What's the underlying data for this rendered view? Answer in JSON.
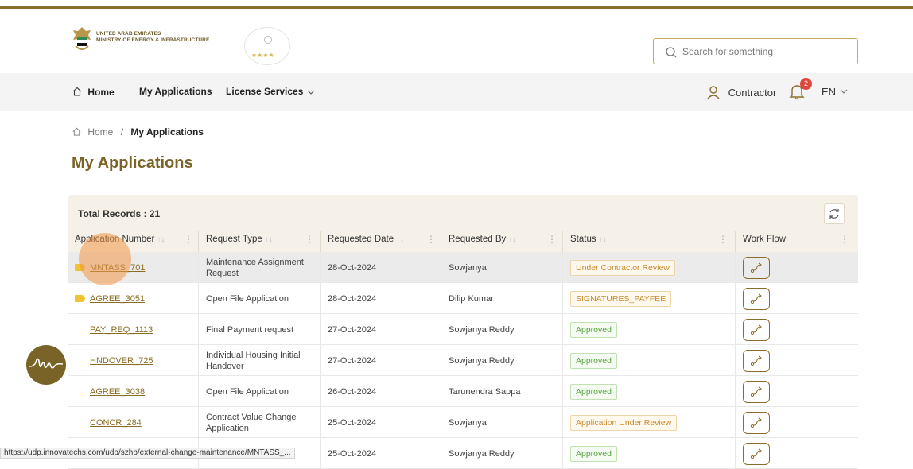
{
  "header": {
    "org_line1": "UNITED ARAB EMIRATES",
    "org_line2": "MINISTRY OF ENERGY & INFRASTRUCTURE",
    "seal_stars": "★★★★",
    "search_placeholder": "Search for something"
  },
  "nav": {
    "home": "Home",
    "my_applications": "My Applications",
    "license_services": "License Services",
    "user": "Contractor",
    "notification_count": "2",
    "language": "EN"
  },
  "breadcrumb": {
    "home": "Home",
    "separator": "/",
    "current": "My Applications"
  },
  "page_title": "My Applications",
  "table": {
    "total_records": "Total Records : 21",
    "columns": {
      "app_number": "Application Number",
      "request_type": "Request Type",
      "requested_date": "Requested Date",
      "requested_by": "Requested By",
      "status": "Status",
      "work_flow": "Work Flow"
    },
    "rows": [
      {
        "app_number": "MNTASS_701",
        "request_type": "Maintenance Assignment Request",
        "requested_date": "28-Oct-2024",
        "requested_by": "Sowjanya",
        "status": "Under Contractor Review",
        "status_color": "orange",
        "flag": true
      },
      {
        "app_number": "AGREE_3051",
        "request_type": "Open File Application",
        "requested_date": "28-Oct-2024",
        "requested_by": "Dilip Kumar",
        "status": "SIGNATURES_PAYFEE",
        "status_color": "orange",
        "flag": true
      },
      {
        "app_number": "PAY_REQ_1113",
        "request_type": "Final Payment request",
        "requested_date": "27-Oct-2024",
        "requested_by": "Sowjanya Reddy",
        "status": "Approved",
        "status_color": "green",
        "flag": false
      },
      {
        "app_number": "HNDOVER_725",
        "request_type": "Individual Housing Initial Handover",
        "requested_date": "27-Oct-2024",
        "requested_by": "Sowjanya Reddy",
        "status": "Approved",
        "status_color": "green",
        "flag": false
      },
      {
        "app_number": "AGREE_3038",
        "request_type": "Open File Application",
        "requested_date": "26-Oct-2024",
        "requested_by": "Tarunendra Sappa",
        "status": "Approved",
        "status_color": "green",
        "flag": false
      },
      {
        "app_number": "CONCR_284",
        "request_type": "Contract Value Change Application",
        "requested_date": "25-Oct-2024",
        "requested_by": "Sowjanya",
        "status": "Application Under Review",
        "status_color": "orange",
        "flag": false
      },
      {
        "app_number": "",
        "request_type": "",
        "requested_date": "25-Oct-2024",
        "requested_by": "Sowjanya Reddy",
        "status": "Approved",
        "status_color": "green",
        "flag": false
      }
    ]
  },
  "status_url": "https://udp.innovatechs.com/udp/szhp/external-change-maintenance/MNTASS_...",
  "colors": {
    "brand_gold": "#8b6d2b",
    "title_gold": "#7a6327",
    "badge_red": "#e0463b"
  }
}
